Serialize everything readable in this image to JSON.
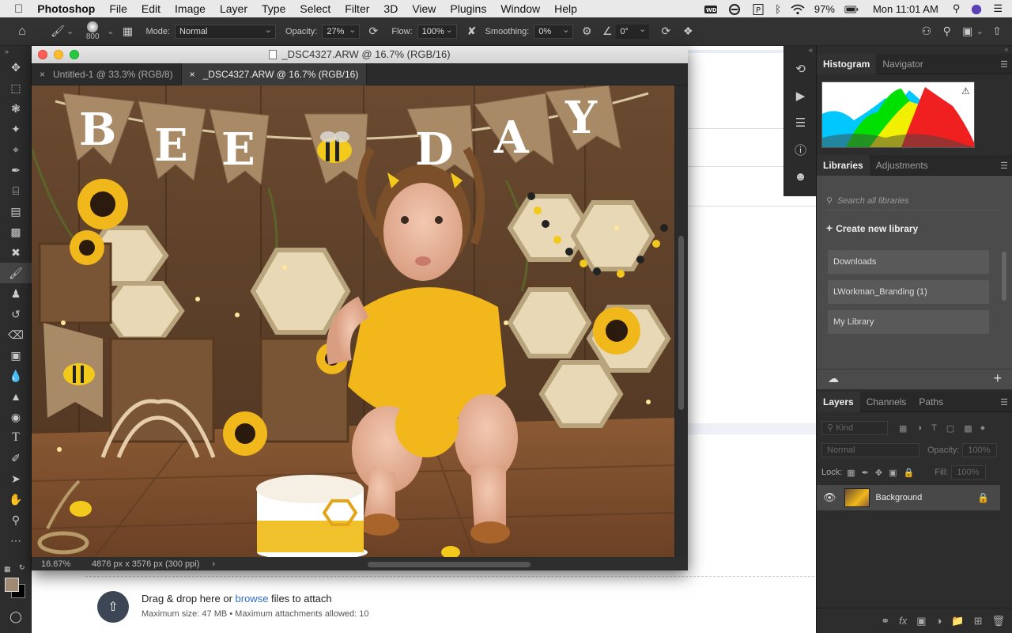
{
  "menubar": {
    "app": "Photoshop",
    "items": [
      "File",
      "Edit",
      "Image",
      "Layer",
      "Type",
      "Select",
      "Filter",
      "3D",
      "View",
      "Plugins",
      "Window",
      "Help"
    ],
    "battery": "97%",
    "clock": "Mon 11:01 AM"
  },
  "options": {
    "brush_size": "800",
    "mode_label": "Mode:",
    "mode_value": "Normal",
    "opacity_label": "Opacity:",
    "opacity_value": "27%",
    "flow_label": "Flow:",
    "flow_value": "100%",
    "smoothing_label": "Smoothing:",
    "smoothing_value": "0%",
    "angle_value": "0°"
  },
  "document": {
    "window_title": "_DSC4327.ARW @ 16.7% (RGB/16)",
    "tabs": [
      {
        "label": "Untitled-1 @ 33.3% (RGB/8)"
      },
      {
        "label": "_DSC4327.ARW @ 16.7% (RGB/16)"
      }
    ],
    "zoom": "16.67%",
    "doc_info": "4876 px x 3576 px (300 ppi)",
    "banner_letters": [
      "B",
      "E",
      "E",
      "D",
      "A",
      "Y"
    ]
  },
  "dropzone": {
    "text_before": "Drag & drop here or ",
    "link": "browse",
    "text_after": " files to attach",
    "sub": "Maximum size: 47 MB • Maximum attachments allowed: 10"
  },
  "panels": {
    "top_tabs": [
      "Histogram",
      "Navigator"
    ],
    "lib_tabs": [
      "Libraries",
      "Adjustments"
    ],
    "lib_search_placeholder": "Search all libraries",
    "lib_create": "Create new library",
    "libraries": [
      "Downloads",
      "LWorkman_Branding (1)",
      "My Library"
    ],
    "layer_tabs": [
      "Layers",
      "Channels",
      "Paths"
    ],
    "kind_placeholder": "Kind",
    "blend_mode": "Normal",
    "opacity_label": "Opacity:",
    "opacity_value": "100%",
    "lock_label": "Lock:",
    "fill_label": "Fill:",
    "fill_value": "100%",
    "layer_name": "Background"
  }
}
